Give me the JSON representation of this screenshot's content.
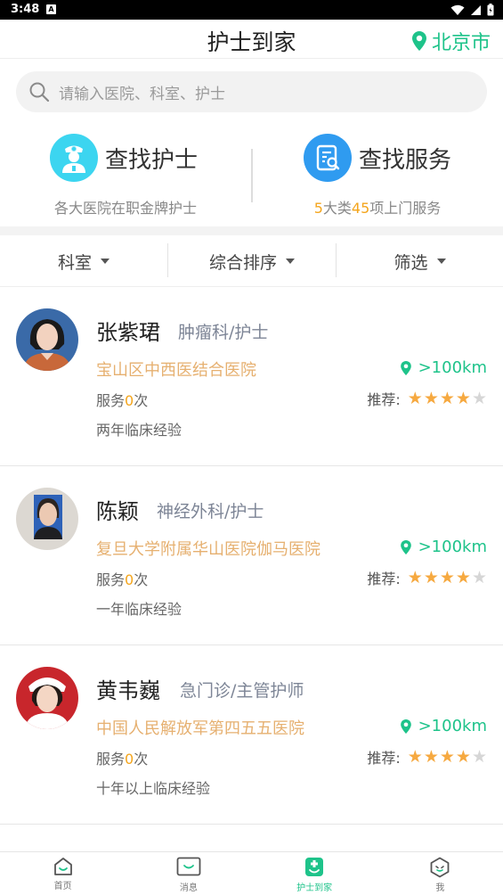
{
  "status_bar": {
    "time": "3:48",
    "notif_icon": "A"
  },
  "header": {
    "title": "护士到家",
    "city": "北京市"
  },
  "search": {
    "placeholder": "请输入医院、科室、护士"
  },
  "quick_actions": [
    {
      "title": "查找护士",
      "subtitle": "各大医院在职金牌护士",
      "icon": "nurse-icon",
      "color": "#3cd5f0"
    },
    {
      "title": "查找服务",
      "subtitle_parts": [
        "5",
        "大类",
        "45",
        "项上门服务"
      ],
      "icon": "service-list-icon",
      "color": "#2f9bf0"
    }
  ],
  "filters": [
    "科室",
    "综合排序",
    "筛选"
  ],
  "nurses": [
    {
      "name": "张紫珺",
      "dept": "肿瘤科/护士",
      "hospital": "宝山区中西医结合医院",
      "distance": ">100km",
      "service_prefix": "服务",
      "service_count": "0",
      "service_suffix": "次",
      "recommend_label": "推荐:",
      "rating": 4,
      "experience": "两年临床经验"
    },
    {
      "name": "陈颖",
      "dept": "神经外科/护士",
      "hospital": "复旦大学附属华山医院伽马医院",
      "distance": ">100km",
      "service_prefix": "服务",
      "service_count": "0",
      "service_suffix": "次",
      "recommend_label": "推荐:",
      "rating": 4,
      "experience": "一年临床经验"
    },
    {
      "name": "黄韦巍",
      "dept": "急门诊/主管护师",
      "hospital": "中国人民解放军第四五五医院",
      "distance": ">100km",
      "service_prefix": "服务",
      "service_count": "0",
      "service_suffix": "次",
      "recommend_label": "推荐:",
      "rating": 4,
      "experience": "十年以上临床经验"
    }
  ],
  "bottom_nav": [
    {
      "label": "首页",
      "icon": "home-icon"
    },
    {
      "label": "消息",
      "icon": "message-icon"
    },
    {
      "label": "护士到家",
      "icon": "nurse-home-icon",
      "active": true
    },
    {
      "label": "我",
      "icon": "profile-icon"
    }
  ],
  "colors": {
    "accent_green": "#1ec38a",
    "highlight_orange": "#f4a51c",
    "star": "#f6a940",
    "hospital_text": "#e6b070"
  }
}
